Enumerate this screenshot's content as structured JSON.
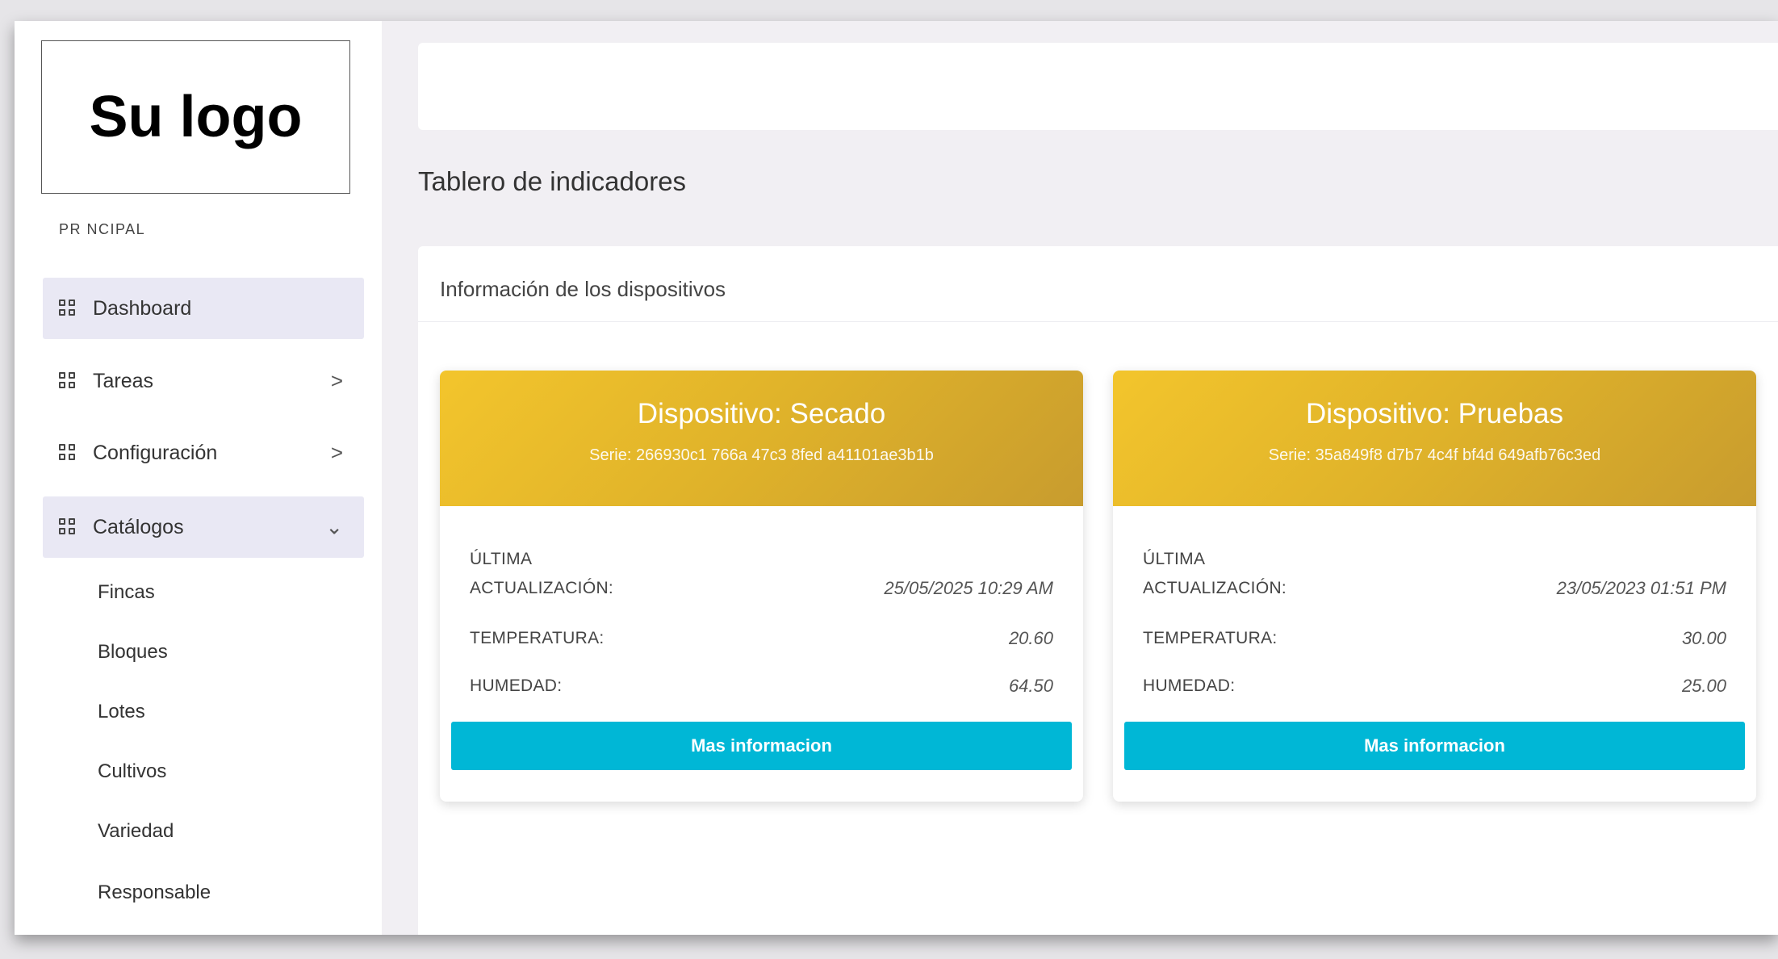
{
  "logo": {
    "text": "Su logo"
  },
  "sidebar": {
    "section_label": "PR NCIPAL",
    "items": [
      {
        "label": "Dashboard",
        "icon": "grid-icon",
        "active": true
      },
      {
        "label": "Tareas",
        "icon": "grid-icon",
        "chevron": ">"
      },
      {
        "label": "Configuración",
        "icon": "grid-icon",
        "chevron": ">"
      },
      {
        "label": "Catálogos",
        "icon": "grid-icon",
        "chevron": "⌄",
        "active": true
      }
    ],
    "sub_items": [
      "Fincas",
      "Bloques",
      "Lotes",
      "Cultivos",
      "Variedad",
      "Responsable"
    ]
  },
  "main": {
    "title": "Tablero de indicadores",
    "card_title": "Información de los dispositivos",
    "devices": [
      {
        "name": "Dispositivo: Secado",
        "serie": "Serie: 266930c1 766a 47c3 8fed a41101ae3b1b",
        "update_label_1": "ÚLTIMA",
        "update_label_2": "ACTUALIZACIÓN:",
        "update_value": "25/05/2025 10:29 AM",
        "temp_label": "TEMPERATURA:",
        "temp_value": "20.60",
        "hum_label": "HUMEDAD:",
        "hum_value": "64.50",
        "button": "Mas informacion"
      },
      {
        "name": "Dispositivo: Pruebas",
        "serie": "Serie: 35a849f8 d7b7 4c4f bf4d 649afb76c3ed",
        "update_label_1": "ÚLTIMA",
        "update_label_2": "ACTUALIZACIÓN:",
        "update_value": "23/05/2023 01:51 PM",
        "temp_label": "TEMPERATURA:",
        "temp_value": "30.00",
        "hum_label": "HUMEDAD:",
        "hum_value": "25.00",
        "button": "Mas informacion"
      }
    ]
  },
  "colors": {
    "accent_cyan": "#00b7d6",
    "header_gold": "#dfb22a",
    "active_nav_bg": "#e9e8f4"
  }
}
